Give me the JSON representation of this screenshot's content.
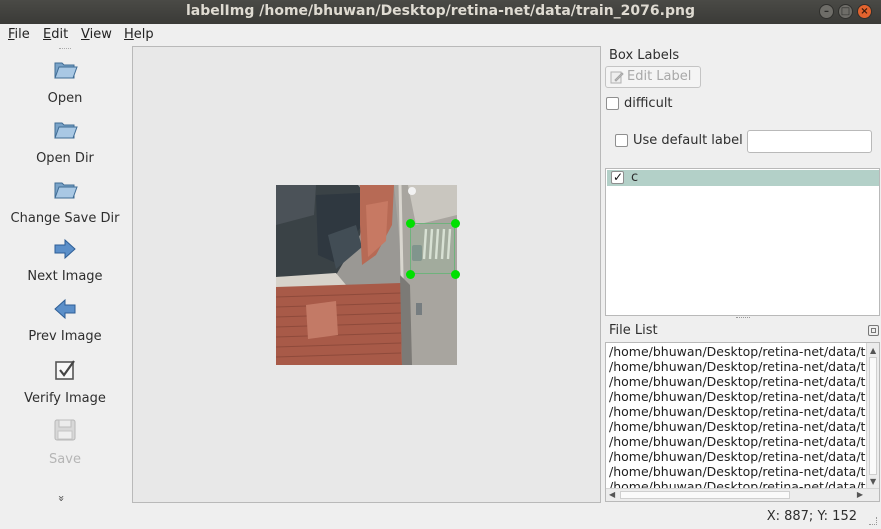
{
  "window": {
    "title": "labelImg /home/bhuwan/Desktop/retina-net/data/train_2076.png",
    "controls": {
      "minimize": "–",
      "maximize": "□",
      "close": "×"
    }
  },
  "menu": [
    {
      "label": "File",
      "mnemonic": "F",
      "rest": "ile"
    },
    {
      "label": "Edit",
      "mnemonic": "E",
      "rest": "dit"
    },
    {
      "label": "View",
      "mnemonic": "V",
      "rest": "iew"
    },
    {
      "label": "Help",
      "mnemonic": "H",
      "rest": "elp"
    }
  ],
  "toolbar": {
    "open": {
      "label": "Open",
      "icon": "folder-open-icon"
    },
    "open_dir": {
      "label": "Open Dir",
      "icon": "folder-open-icon"
    },
    "change_save_dir": {
      "label": "Change Save Dir",
      "icon": "folder-open-icon"
    },
    "next_image": {
      "label": "Next Image",
      "icon": "arrow-right-icon"
    },
    "prev_image": {
      "label": "Prev Image",
      "icon": "arrow-left-icon"
    },
    "verify_image": {
      "label": "Verify Image",
      "icon": "checkbox-icon"
    },
    "save": {
      "label": "Save",
      "icon": "floppy-disk-icon",
      "enabled": false
    },
    "more": "»"
  },
  "box_labels": {
    "title": "Box Labels",
    "edit_label_button": "Edit Label",
    "difficult_label": "difficult",
    "difficult_checked": false,
    "use_default_label": "Use default label",
    "use_default_checked": false,
    "default_label_value": "",
    "labels": [
      {
        "name": "c",
        "checked": true,
        "check_glyph": "✓"
      }
    ]
  },
  "file_list": {
    "title": "File List",
    "items": [
      "/home/bhuwan/Desktop/retina-net/data/tra",
      "/home/bhuwan/Desktop/retina-net/data/tra",
      "/home/bhuwan/Desktop/retina-net/data/tra",
      "/home/bhuwan/Desktop/retina-net/data/tra",
      "/home/bhuwan/Desktop/retina-net/data/tra",
      "/home/bhuwan/Desktop/retina-net/data/tra",
      "/home/bhuwan/Desktop/retina-net/data/tra",
      "/home/bhuwan/Desktop/retina-net/data/tra",
      "/home/bhuwan/Desktop/retina-net/data/tra",
      "/home/bhuwan/Desktop/retina-net/data/tra"
    ]
  },
  "status": {
    "coords": "X: 887; Y: 152"
  },
  "colors": {
    "selection": "#b3d0c8",
    "bbox_stroke": "#6fb27c",
    "handle": "#00e000",
    "titlebar": "#3c3b37"
  }
}
